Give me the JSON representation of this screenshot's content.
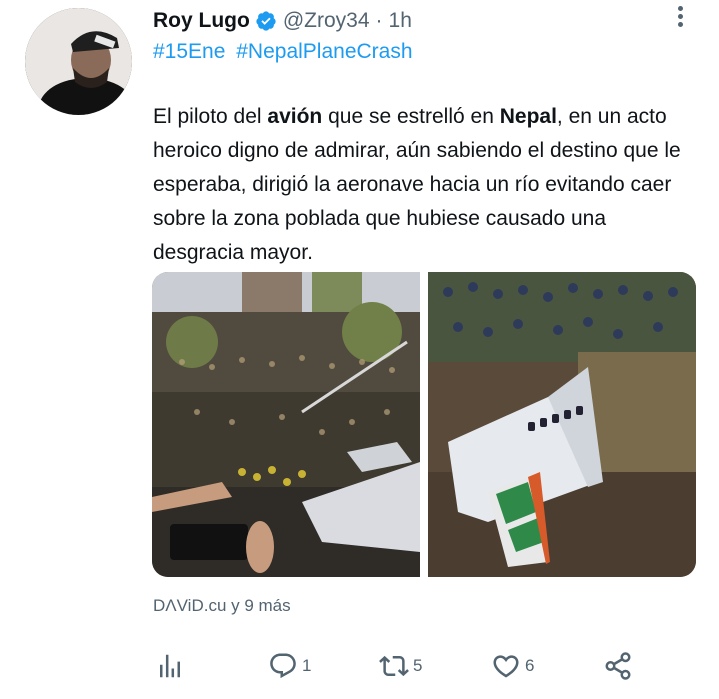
{
  "tweet": {
    "author_name": "Roy Lugo",
    "handle": "@Zroy34",
    "separator": "·",
    "time": "1h",
    "hashtags": [
      "#15Ene",
      "#NepalPlaneCrash"
    ],
    "text_parts": [
      "El piloto del ",
      "avión",
      " que se estrelló en ",
      "Nepal",
      ", en un acto heroico digno de admirar, aún sabiendo el destino que le esperaba, dirigió la aeronave hacia un río evitando caer sobre la zona poblada que hubiese causado una desgracia mayor."
    ],
    "tagged": "DΛViD.cu y 9 más"
  },
  "actions": {
    "replies": "1",
    "retweets": "5",
    "likes": "6"
  },
  "icons": {
    "verified": "verified-badge-icon",
    "more": "more-options-icon",
    "analytics": "analytics-icon",
    "reply": "reply-icon",
    "retweet": "retweet-icon",
    "like": "heart-icon",
    "share": "share-icon"
  },
  "colors": {
    "accent": "#1d9bf0",
    "text": "#0f1419",
    "secondary": "#536471"
  }
}
